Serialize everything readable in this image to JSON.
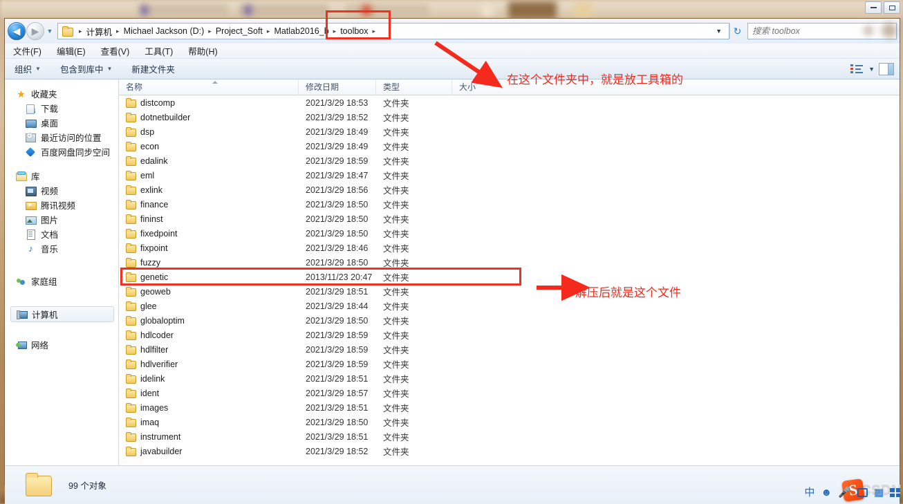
{
  "window": {
    "controls": {
      "minimize": "minimize-button",
      "restore": "restore-button"
    }
  },
  "nav": {
    "back_label": "◀",
    "forward_label": "▶",
    "history_dropdown": "▼",
    "refresh_label": "↻"
  },
  "breadcrumb": {
    "items": [
      "计算机",
      "Michael Jackson (D:)",
      "Project_Soft",
      "Matlab2016_b",
      "toolbox"
    ],
    "separator": "▸",
    "dropdown": "▼"
  },
  "search": {
    "placeholder": "搜索 toolbox",
    "value": ""
  },
  "menubar": {
    "items": [
      "文件(F)",
      "编辑(E)",
      "查看(V)",
      "工具(T)",
      "帮助(H)"
    ]
  },
  "toolbar": {
    "organize": "组织",
    "include_in_library": "包含到库中",
    "new_folder": "新建文件夹",
    "caret": "▼",
    "view_caret": "▼"
  },
  "sidebar": {
    "groups": [
      {
        "header": {
          "label": "收藏夹",
          "icon": "star-icon"
        },
        "items": [
          {
            "label": "下载",
            "icon": "download-icon"
          },
          {
            "label": "桌面",
            "icon": "desktop-icon"
          },
          {
            "label": "最近访问的位置",
            "icon": "recent-places-icon"
          },
          {
            "label": "百度网盘同步空间",
            "icon": "baidu-netdisk-icon"
          }
        ]
      },
      {
        "header": {
          "label": "库",
          "icon": "library-icon"
        },
        "items": [
          {
            "label": "视频",
            "icon": "video-icon"
          },
          {
            "label": "腾讯视频",
            "icon": "tencent-video-icon"
          },
          {
            "label": "图片",
            "icon": "pictures-icon"
          },
          {
            "label": "文档",
            "icon": "documents-icon"
          },
          {
            "label": "音乐",
            "icon": "music-icon"
          }
        ]
      },
      {
        "header": {
          "label": "家庭组",
          "icon": "homegroup-icon"
        },
        "items": []
      },
      {
        "header": {
          "label": "计算机",
          "icon": "computer-icon",
          "selected": true
        },
        "items": []
      },
      {
        "header": {
          "label": "网络",
          "icon": "network-icon"
        },
        "items": []
      }
    ]
  },
  "filelist": {
    "columns": [
      "名称",
      "修改日期",
      "类型",
      "大小"
    ],
    "sorted_column": "名称",
    "rows": [
      {
        "name": "distcomp",
        "date": "2021/3/29 18:53",
        "type": "文件夹",
        "size": ""
      },
      {
        "name": "dotnetbuilder",
        "date": "2021/3/29 18:52",
        "type": "文件夹",
        "size": ""
      },
      {
        "name": "dsp",
        "date": "2021/3/29 18:49",
        "type": "文件夹",
        "size": ""
      },
      {
        "name": "econ",
        "date": "2021/3/29 18:49",
        "type": "文件夹",
        "size": ""
      },
      {
        "name": "edalink",
        "date": "2021/3/29 18:59",
        "type": "文件夹",
        "size": ""
      },
      {
        "name": "eml",
        "date": "2021/3/29 18:47",
        "type": "文件夹",
        "size": ""
      },
      {
        "name": "exlink",
        "date": "2021/3/29 18:56",
        "type": "文件夹",
        "size": ""
      },
      {
        "name": "finance",
        "date": "2021/3/29 18:50",
        "type": "文件夹",
        "size": ""
      },
      {
        "name": "fininst",
        "date": "2021/3/29 18:50",
        "type": "文件夹",
        "size": ""
      },
      {
        "name": "fixedpoint",
        "date": "2021/3/29 18:50",
        "type": "文件夹",
        "size": ""
      },
      {
        "name": "fixpoint",
        "date": "2021/3/29 18:46",
        "type": "文件夹",
        "size": ""
      },
      {
        "name": "fuzzy",
        "date": "2021/3/29 18:50",
        "type": "文件夹",
        "size": ""
      },
      {
        "name": "genetic",
        "date": "2013/11/23 20:47",
        "type": "文件夹",
        "size": ""
      },
      {
        "name": "geoweb",
        "date": "2021/3/29 18:51",
        "type": "文件夹",
        "size": ""
      },
      {
        "name": "glee",
        "date": "2021/3/29 18:44",
        "type": "文件夹",
        "size": ""
      },
      {
        "name": "globaloptim",
        "date": "2021/3/29 18:50",
        "type": "文件夹",
        "size": ""
      },
      {
        "name": "hdlcoder",
        "date": "2021/3/29 18:59",
        "type": "文件夹",
        "size": ""
      },
      {
        "name": "hdlfilter",
        "date": "2021/3/29 18:59",
        "type": "文件夹",
        "size": ""
      },
      {
        "name": "hdlverifier",
        "date": "2021/3/29 18:59",
        "type": "文件夹",
        "size": ""
      },
      {
        "name": "idelink",
        "date": "2021/3/29 18:51",
        "type": "文件夹",
        "size": ""
      },
      {
        "name": "ident",
        "date": "2021/3/29 18:57",
        "type": "文件夹",
        "size": ""
      },
      {
        "name": "images",
        "date": "2021/3/29 18:51",
        "type": "文件夹",
        "size": ""
      },
      {
        "name": "imaq",
        "date": "2021/3/29 18:50",
        "type": "文件夹",
        "size": ""
      },
      {
        "name": "instrument",
        "date": "2021/3/29 18:51",
        "type": "文件夹",
        "size": ""
      },
      {
        "name": "javabuilder",
        "date": "2021/3/29 18:52",
        "type": "文件夹",
        "size": ""
      }
    ],
    "highlighted_row": "genetic"
  },
  "statusbar": {
    "text": "99 个对象"
  },
  "annotations": {
    "accent_color": "#f42b1c",
    "note_toolbox": "在这个文件夹中，就是放工具箱的",
    "note_genetic": "解压后就是这个文件"
  },
  "watermark": {
    "logo_glyph": "S",
    "text": "CSDN"
  }
}
